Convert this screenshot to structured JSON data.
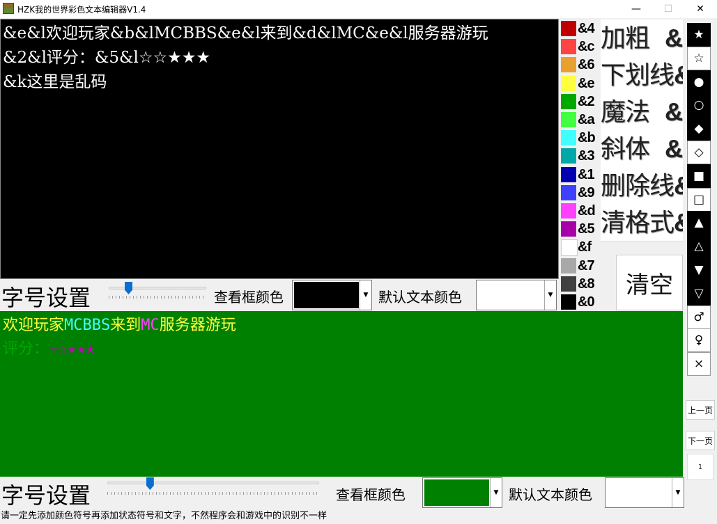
{
  "window": {
    "title": "HZK我的世界彩色文本编辑器V1.4",
    "minimize": "—",
    "maximize": "☐",
    "close": "✕"
  },
  "editor": {
    "lines": [
      "&e&l欢迎玩家&b&lMCBBS&e&l来到&d&lMC&e&l服务器游玩",
      "&2&l评分：&5&l☆☆★★★",
      "&k这里是乱码"
    ]
  },
  "colors": [
    {
      "code": "&4",
      "hex": "#c00000"
    },
    {
      "code": "&c",
      "hex": "#ff4444"
    },
    {
      "code": "&6",
      "hex": "#e8a030"
    },
    {
      "code": "&e",
      "hex": "#ffff40"
    },
    {
      "code": "&2",
      "hex": "#00a800"
    },
    {
      "code": "&a",
      "hex": "#40ff40"
    },
    {
      "code": "&b",
      "hex": "#40ffff"
    },
    {
      "code": "&3",
      "hex": "#00a8a8"
    },
    {
      "code": "&1",
      "hex": "#0000b0"
    },
    {
      "code": "&9",
      "hex": "#4040ff"
    },
    {
      "code": "&d",
      "hex": "#ff40ff"
    },
    {
      "code": "&5",
      "hex": "#a800a8"
    },
    {
      "code": "&f",
      "hex": "#ffffff"
    },
    {
      "code": "&7",
      "hex": "#a8a8a8"
    },
    {
      "code": "&8",
      "hex": "#404040"
    },
    {
      "code": "&0",
      "hex": "#000000"
    }
  ],
  "formats": [
    {
      "label": "加粗",
      "code": "&l"
    },
    {
      "label": "下划线",
      "code": "&n"
    },
    {
      "label": "魔法",
      "code": "&k"
    },
    {
      "label": "斜体",
      "code": "&o"
    },
    {
      "label": "删除线",
      "code": "&m"
    },
    {
      "label": "清格式",
      "code": "&r"
    }
  ],
  "clear_label": "清空",
  "symbols": [
    {
      "glyph": "★",
      "icon": "filled-star-icon",
      "dark": true
    },
    {
      "glyph": "☆",
      "icon": "outline-star-icon",
      "dark": false
    },
    {
      "glyph": "●",
      "icon": "filled-circle-icon",
      "dark": true
    },
    {
      "glyph": "○",
      "icon": "outline-circle-icon",
      "dark": true
    },
    {
      "glyph": "◆",
      "icon": "filled-diamond-icon",
      "dark": true
    },
    {
      "glyph": "◇",
      "icon": "outline-diamond-icon",
      "dark": false
    },
    {
      "glyph": "■",
      "icon": "filled-square-icon",
      "dark": true
    },
    {
      "glyph": "□",
      "icon": "outline-square-icon",
      "dark": false
    },
    {
      "glyph": "▲",
      "icon": "filled-triangle-up-icon",
      "dark": true
    },
    {
      "glyph": "△",
      "icon": "outline-triangle-up-icon",
      "dark": true
    },
    {
      "glyph": "▼",
      "icon": "filled-triangle-down-icon",
      "dark": true
    },
    {
      "glyph": "▽",
      "icon": "outline-triangle-down-icon",
      "dark": true
    },
    {
      "glyph": "♂",
      "icon": "male-symbol-icon",
      "dark": false
    },
    {
      "glyph": "♀",
      "icon": "female-symbol-icon",
      "dark": false
    },
    {
      "glyph": "×",
      "icon": "multiply-icon",
      "dark": false
    }
  ],
  "pager": {
    "prev": "上一页",
    "next": "下一页",
    "page": "1"
  },
  "top_settings": {
    "size_label": "字号设置",
    "view_color_label": "查看框颜色",
    "view_color": "#000000",
    "default_color_label": "默认文本颜色",
    "default_color": "#ffffff",
    "slider_level": 0.2
  },
  "preview": {
    "lines": [
      [
        {
          "text": "欢迎玩家",
          "color": "#ffff40"
        },
        {
          "text": "MCBBS",
          "color": "#40ffff"
        },
        {
          "text": "来到",
          "color": "#ffff40"
        },
        {
          "text": "MC",
          "color": "#ff40ff"
        },
        {
          "text": "服务器游玩",
          "color": "#ffff40"
        }
      ],
      [
        {
          "text": "评分：",
          "color": "#00a800"
        },
        {
          "text": "☆☆★★★",
          "color": "#c000c0"
        }
      ]
    ]
  },
  "bottom_settings": {
    "size_label": "字号设置",
    "view_color_label": "查看框颜色",
    "view_color": "#008000",
    "default_color_label": "默认文本颜色",
    "default_color": "#ffffff",
    "slider_level": 0.2
  },
  "status": "请一定先添加颜色符号再添加状态符号和文字，不然程序会和游戏中的识别不一样"
}
